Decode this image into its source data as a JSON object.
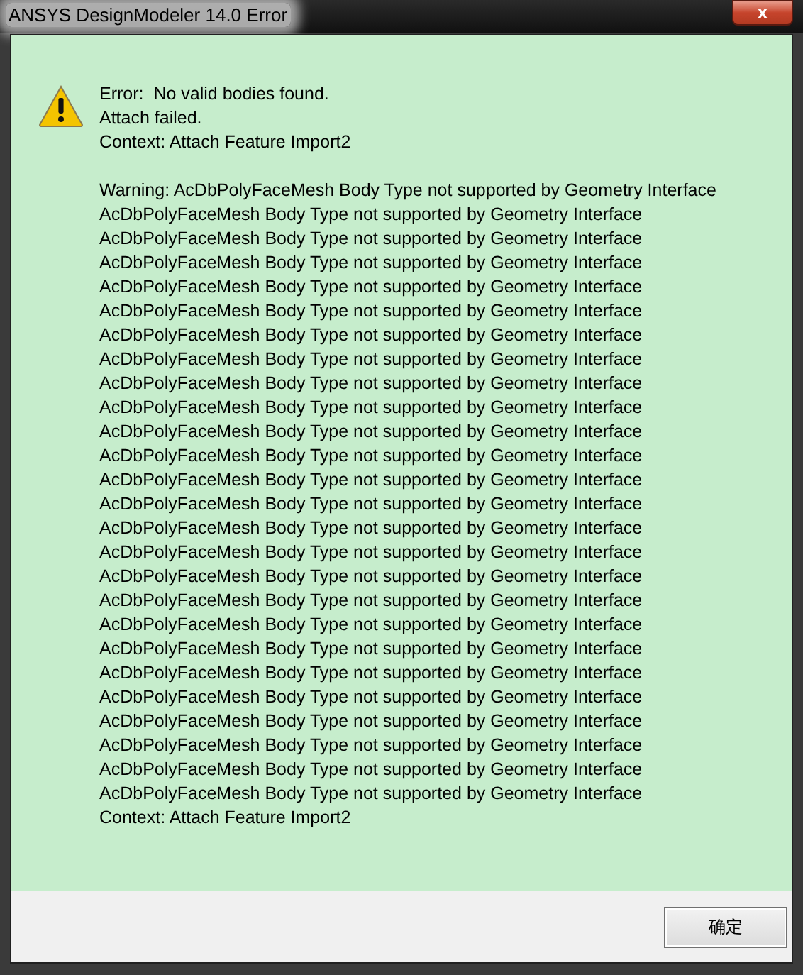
{
  "window": {
    "title": "ANSYS DesignModeler 14.0 Error",
    "close_button": "x"
  },
  "message": {
    "summary": [
      "Error:  No valid bodies found.",
      "Attach failed.",
      "Context: Attach Feature Import2"
    ],
    "details": [
      "Warning: AcDbPolyFaceMesh Body Type not supported by Geometry Interface",
      "AcDbPolyFaceMesh Body Type not supported by Geometry Interface",
      "AcDbPolyFaceMesh Body Type not supported by Geometry Interface",
      "AcDbPolyFaceMesh Body Type not supported by Geometry Interface",
      "AcDbPolyFaceMesh Body Type not supported by Geometry Interface",
      "AcDbPolyFaceMesh Body Type not supported by Geometry Interface",
      "AcDbPolyFaceMesh Body Type not supported by Geometry Interface",
      "AcDbPolyFaceMesh Body Type not supported by Geometry Interface",
      "AcDbPolyFaceMesh Body Type not supported by Geometry Interface",
      "AcDbPolyFaceMesh Body Type not supported by Geometry Interface",
      "AcDbPolyFaceMesh Body Type not supported by Geometry Interface",
      "AcDbPolyFaceMesh Body Type not supported by Geometry Interface",
      "AcDbPolyFaceMesh Body Type not supported by Geometry Interface",
      "AcDbPolyFaceMesh Body Type not supported by Geometry Interface",
      "AcDbPolyFaceMesh Body Type not supported by Geometry Interface",
      "AcDbPolyFaceMesh Body Type not supported by Geometry Interface",
      "AcDbPolyFaceMesh Body Type not supported by Geometry Interface",
      "AcDbPolyFaceMesh Body Type not supported by Geometry Interface",
      "AcDbPolyFaceMesh Body Type not supported by Geometry Interface",
      "AcDbPolyFaceMesh Body Type not supported by Geometry Interface",
      "AcDbPolyFaceMesh Body Type not supported by Geometry Interface",
      "AcDbPolyFaceMesh Body Type not supported by Geometry Interface",
      "AcDbPolyFaceMesh Body Type not supported by Geometry Interface",
      "AcDbPolyFaceMesh Body Type not supported by Geometry Interface",
      "AcDbPolyFaceMesh Body Type not supported by Geometry Interface",
      "AcDbPolyFaceMesh Body Type not supported by Geometry Interface",
      "Context: Attach Feature Import2"
    ]
  },
  "buttons": [
    "确定"
  ]
}
